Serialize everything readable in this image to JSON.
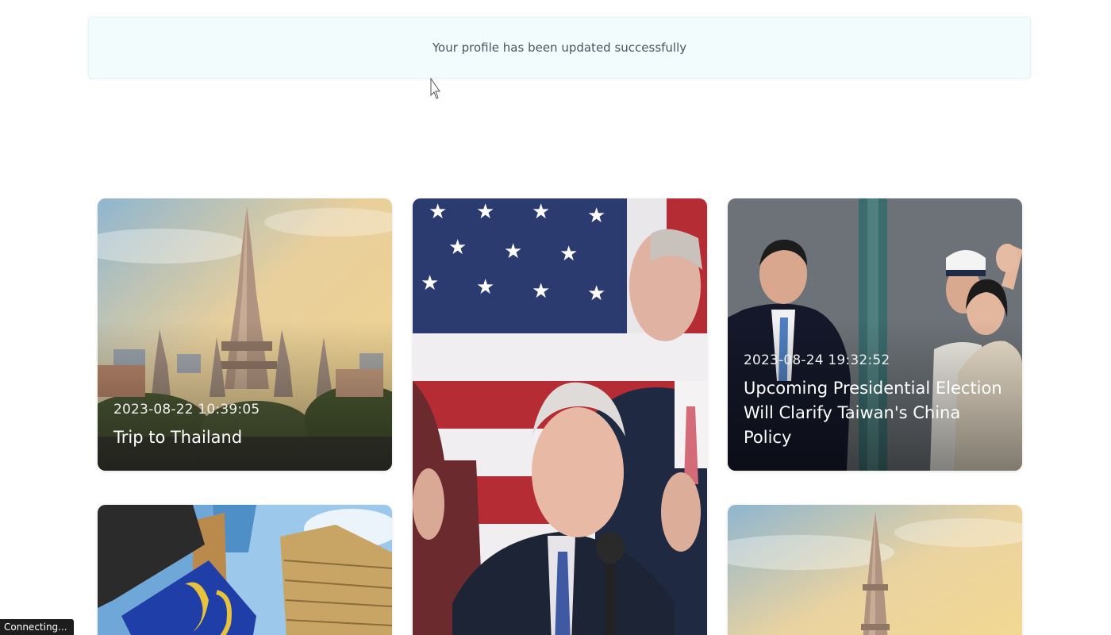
{
  "alert": {
    "message": "Your profile has been updated successfully"
  },
  "cards": [
    {
      "date": "2023-08-22 10:39:05",
      "title": "Trip to Thailand",
      "image_icon": "temple-photo"
    },
    {
      "date": "",
      "title": "",
      "image_icon": "flag-speaker-photo"
    },
    {
      "date": "2023-08-24 19:32:52",
      "title": "Upcoming Presidential Election Will Clarify Taiwan's China Policy",
      "image_icon": "politicians-photo"
    },
    {
      "date": "",
      "title": "",
      "image_icon": "skyscraper-photo"
    },
    {
      "date": "",
      "title": "",
      "image_icon": "temple-photo"
    }
  ],
  "status": {
    "text": "Connecting..."
  }
}
